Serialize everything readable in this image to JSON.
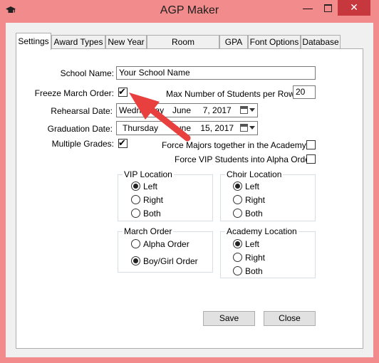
{
  "window": {
    "title": "AGP Maker",
    "minimize": "—",
    "close": "✕"
  },
  "tabs": [
    "Settings",
    "Award Types",
    "New Year",
    "Room Assignments",
    "GPA",
    "Font Options",
    "Database"
  ],
  "settings": {
    "school_name_label": "School Name:",
    "school_name_value": "Your School Name",
    "freeze_march_label": "Freeze March Order:",
    "freeze_march_checked": true,
    "max_students_label": "Max Number of Students per Row:",
    "max_students_value": "20",
    "rehearsal_label": "Rehearsal Date:",
    "rehearsal_day": "Wednesday",
    "rehearsal_date": "June     7, 2017",
    "graduation_label": "Graduation Date:",
    "graduation_day": "Thursday",
    "graduation_date": "June    15, 2017",
    "multiple_grades_label": "Multiple Grades:",
    "multiple_grades_checked": true,
    "force_majors_label": "Force Majors together in the Academys",
    "force_vip_label": "Force VIP Students into Alpha Order"
  },
  "groups": {
    "vip_location": {
      "legend": "VIP Location",
      "options": [
        "Left",
        "Right",
        "Both"
      ],
      "selected": 0
    },
    "choir_location": {
      "legend": "Choir Location",
      "options": [
        "Left",
        "Right",
        "Both"
      ],
      "selected": 0
    },
    "march_order": {
      "legend": "March Order",
      "options": [
        "Alpha Order",
        "Boy/Girl Order"
      ],
      "selected": 1
    },
    "academy_location": {
      "legend": "Academy Location",
      "options": [
        "Left",
        "Right",
        "Both"
      ],
      "selected": 0
    }
  },
  "buttons": {
    "save": "Save",
    "close": "Close"
  },
  "colors": {
    "titlebar": "#f28c8c",
    "close_button": "#c7383e",
    "annotation_arrow": "#e8403f"
  },
  "icons": {
    "app": "graduation-cap-icon",
    "calendar": "calendar-icon"
  }
}
